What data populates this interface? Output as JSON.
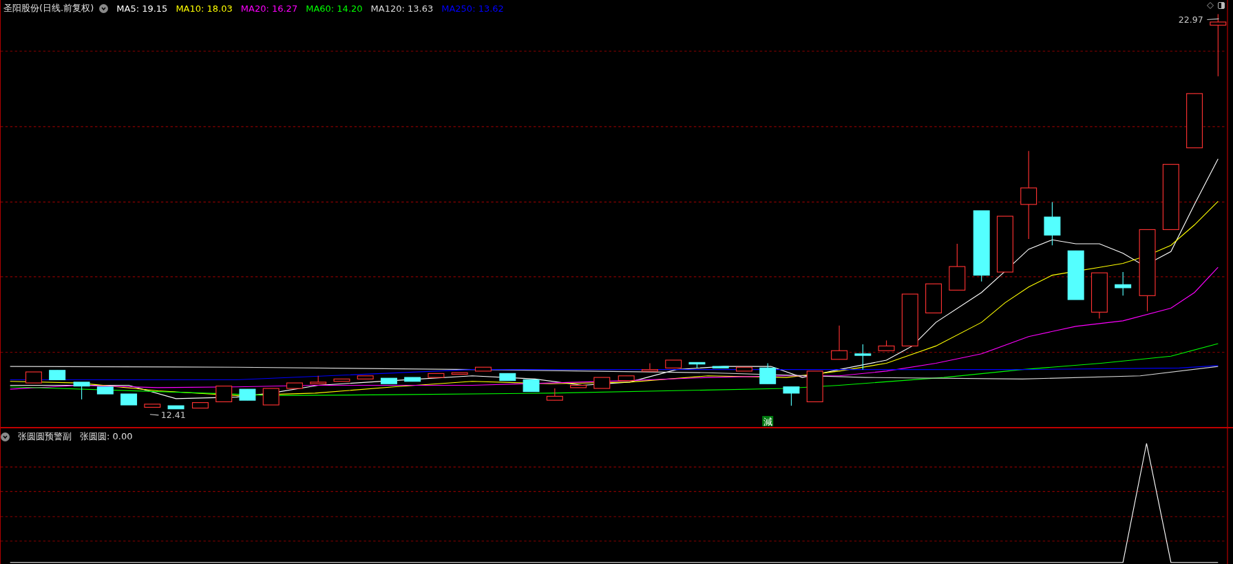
{
  "header": {
    "title": "圣阳股份(日线.前复权)",
    "ma": [
      {
        "label": "MA5: 19.15",
        "color": "#ffffff"
      },
      {
        "label": "MA10: 18.03",
        "color": "#ffff00"
      },
      {
        "label": "MA20: 16.27",
        "color": "#ff00ff"
      },
      {
        "label": "MA60: 14.20",
        "color": "#00ff00"
      },
      {
        "label": "MA120: 13.63",
        "color": "#d8d8d8"
      },
      {
        "label": "MA250: 13.62",
        "color": "#0000ff"
      }
    ]
  },
  "price_labels": [
    {
      "kind": "high",
      "text": "22.97"
    },
    {
      "kind": "low",
      "text": "12.41"
    }
  ],
  "signal_badge": "減",
  "indicator": {
    "title": "张圆圆预警副",
    "reading": "张圆圆: 0.00"
  }
}
